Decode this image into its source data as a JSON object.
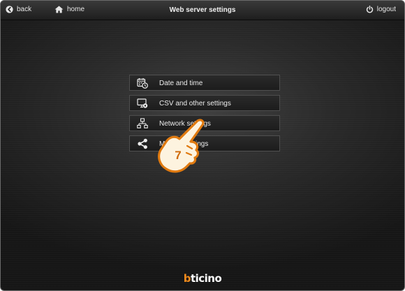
{
  "header": {
    "title": "Web server settings",
    "back_label": "back",
    "home_label": "home",
    "logout_label": "logout"
  },
  "menu": {
    "items": [
      {
        "label": "Date and time",
        "icon": "calendar-clock-icon"
      },
      {
        "label": "CSV and other settings",
        "icon": "monitor-gear-icon"
      },
      {
        "label": "Network settings",
        "icon": "network-icon"
      },
      {
        "label": "Mo",
        "label_tail": "settings",
        "icon": "share-icon"
      }
    ]
  },
  "overlay": {
    "step_number": "7",
    "icon": "pointing-hand-icon"
  },
  "brand": {
    "logo_text": "bticino",
    "accent_color": "#f08a1c"
  },
  "colors": {
    "text": "#ececec",
    "hand_fill": "#fdf3df",
    "hand_outline": "#e07a10"
  }
}
